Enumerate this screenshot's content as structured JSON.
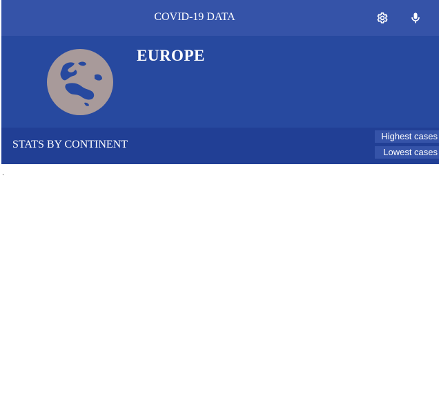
{
  "header": {
    "title": "COVID-19 DATA",
    "icons": [
      "gear-icon",
      "microphone-icon"
    ]
  },
  "hero": {
    "region": "EUROPE",
    "icon": "globe-icon"
  },
  "stats": {
    "label": "STATS BY CONTINENT",
    "sort_options": [
      "Highest cases",
      "Lowest cases"
    ]
  },
  "stray_text": "`",
  "colors": {
    "topbar": "#3553a8",
    "hero": "#27499f",
    "statsbar": "#213f95",
    "globe": "#a89a9a",
    "text": "#ffffff"
  }
}
